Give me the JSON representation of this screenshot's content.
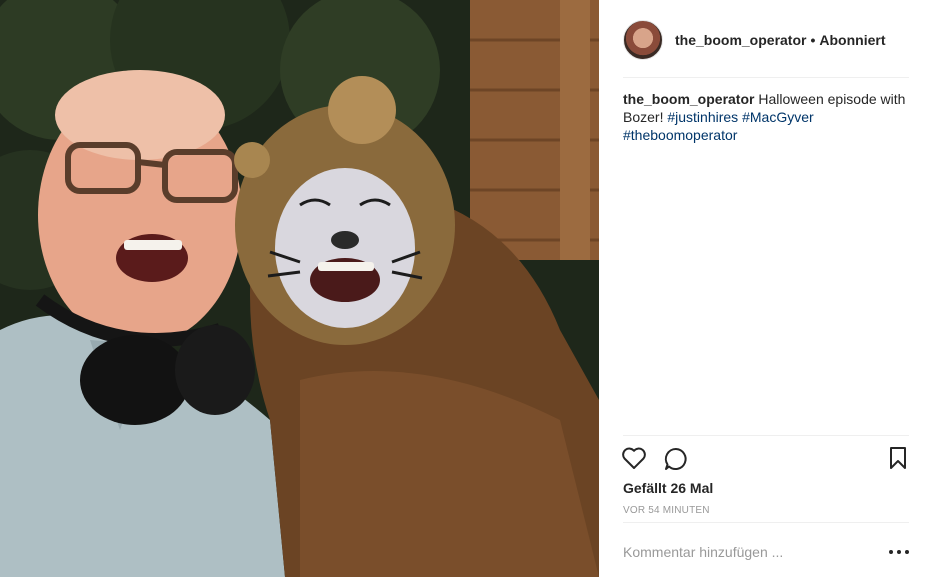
{
  "post": {
    "username": "the_boom_operator",
    "follow_status": "Abonniert",
    "caption_text": " Halloween episode with Bozer! ",
    "hashtags": [
      "#justinhires",
      "#MacGyver",
      "#theboomoperator"
    ],
    "likes": "Gefällt 26 Mal",
    "timestamp": "VOR 54 MINUTEN",
    "comment_placeholder": "Kommentar hinzufügen ..."
  },
  "icons": {
    "like": "heart-icon",
    "comment": "comment-icon",
    "save": "bookmark-icon",
    "options": "more-options-icon"
  },
  "colors": {
    "hashtag": "#003569",
    "muted": "#999999",
    "text": "#262626"
  }
}
